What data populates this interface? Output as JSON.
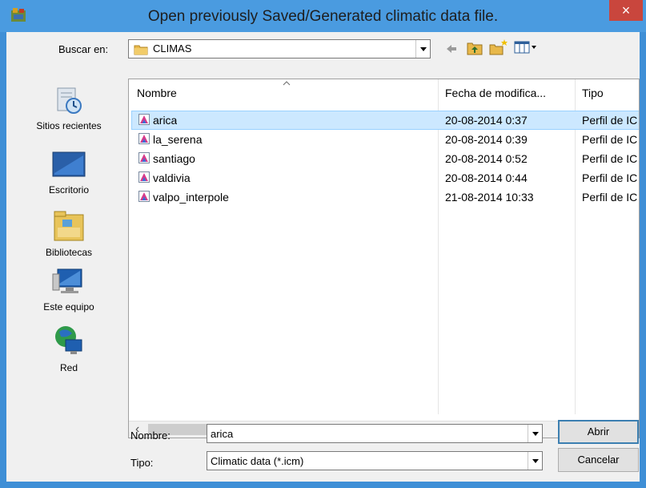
{
  "window": {
    "title": "Open previously Saved/Generated climatic data file.",
    "close_label": "×",
    "accent_color": "#4a9be0"
  },
  "toolbar": {
    "lookin_label": "Buscar en:",
    "lookin_value": "CLIMAS",
    "icons": [
      "back-arrow-icon",
      "up-folder-icon",
      "new-folder-icon",
      "view-menu-icon"
    ]
  },
  "places": [
    {
      "label": "Sitios recientes",
      "icon": "recent-places-icon"
    },
    {
      "label": "Escritorio",
      "icon": "desktop-icon"
    },
    {
      "label": "Bibliotecas",
      "icon": "libraries-icon"
    },
    {
      "label": "Este equipo",
      "icon": "computer-icon"
    },
    {
      "label": "Red",
      "icon": "network-icon"
    }
  ],
  "list": {
    "columns": [
      "Nombre",
      "Fecha de modifica...",
      "Tipo"
    ],
    "rows": [
      {
        "name": "arica",
        "date": "20-08-2014 0:37",
        "type": "Perfil de IC",
        "selected": true
      },
      {
        "name": "la_serena",
        "date": "20-08-2014 0:39",
        "type": "Perfil de IC",
        "selected": false
      },
      {
        "name": "santiago",
        "date": "20-08-2014 0:52",
        "type": "Perfil de IC",
        "selected": false
      },
      {
        "name": "valdivia",
        "date": "20-08-2014 0:44",
        "type": "Perfil de IC",
        "selected": false
      },
      {
        "name": "valpo_interpole",
        "date": "21-08-2014 10:33",
        "type": "Perfil de IC",
        "selected": false
      }
    ],
    "scroll_left": "‹",
    "scroll_right": "›"
  },
  "form": {
    "filename_label": "Nombre:",
    "filename_value": "arica",
    "filetype_label": "Tipo:",
    "filetype_value": "Climatic data (*.icm)",
    "open_button": "Abrir",
    "cancel_button": "Cancelar"
  }
}
